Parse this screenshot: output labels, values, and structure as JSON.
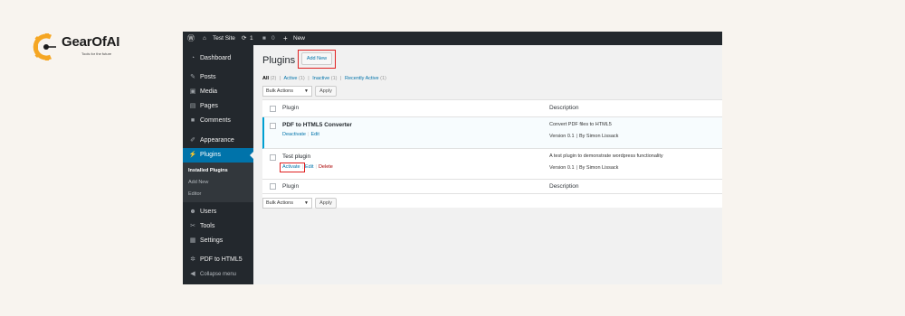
{
  "brand": {
    "name": "GearOfAI",
    "tagline": "Tools for the future",
    "accent": "#f5a623"
  },
  "adminbar": {
    "site_name": "Test Site",
    "updates_count": "1",
    "comments_count": "0",
    "new_label": "New"
  },
  "menu": {
    "items": [
      {
        "label": "Dashboard",
        "icon": "dashboard-icon"
      },
      {
        "label": "Posts",
        "icon": "pin-icon"
      },
      {
        "label": "Media",
        "icon": "media-icon"
      },
      {
        "label": "Pages",
        "icon": "pages-icon"
      },
      {
        "label": "Comments",
        "icon": "comment-icon"
      },
      {
        "label": "Appearance",
        "icon": "brush-icon"
      },
      {
        "label": "Plugins",
        "icon": "plug-icon"
      },
      {
        "label": "Users",
        "icon": "users-icon"
      },
      {
        "label": "Tools",
        "icon": "wrench-icon"
      },
      {
        "label": "Settings",
        "icon": "settings-icon"
      },
      {
        "label": "PDF to HTML5",
        "icon": "gear-icon"
      },
      {
        "label": "Collapse menu",
        "icon": "collapse-icon"
      }
    ],
    "submenu": [
      "Installed Plugins",
      "Add New",
      "Editor"
    ]
  },
  "page": {
    "title": "Plugins",
    "add_new": "Add New",
    "filters": {
      "all": "All",
      "all_count": "(2)",
      "active": "Active",
      "active_count": "(1)",
      "inactive": "Inactive",
      "inactive_count": "(1)",
      "recent": "Recently Active",
      "recent_count": "(1)"
    },
    "bulk_actions": "Bulk Actions",
    "apply": "Apply",
    "columns": {
      "plugin": "Plugin",
      "description": "Description"
    },
    "plugins": [
      {
        "name": "PDF to HTML5 Converter",
        "actions": [
          "Deactivate",
          "Edit"
        ],
        "description": "Convert PDF files to HTML5",
        "version": "Version 0.1",
        "author": "By Simon Lissack"
      },
      {
        "name": "Test plugin",
        "actions": [
          "Activate",
          "Edit",
          "Delete"
        ],
        "description": "A test plugin to demonstrate wordpress functionality",
        "version": "Version 0.1",
        "author": "By Simon Lissack"
      }
    ]
  }
}
